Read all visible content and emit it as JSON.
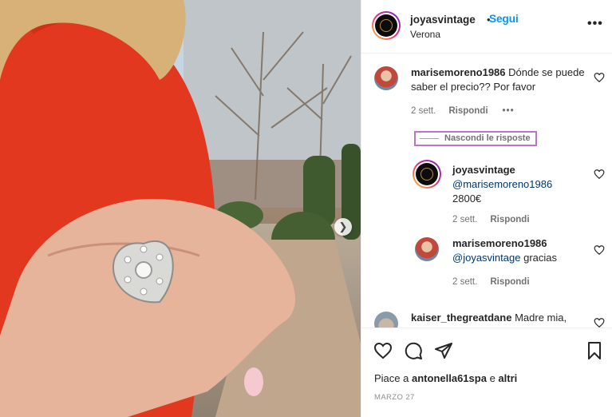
{
  "post": {
    "username": "joyasvintage",
    "separator": "•",
    "follow_label": "Segui",
    "location": "Verona",
    "more": "•••"
  },
  "comments": [
    {
      "username": "marisemoreno1986",
      "text": "Dónde se puede saber el precio?? Por favor",
      "time": "2 sett.",
      "reply_label": "Rispondi",
      "more": "•••"
    },
    {
      "username": "kaiser_thegreatdane",
      "text": "Madre mia,"
    }
  ],
  "hide_replies_label": "Nascondi le risposte",
  "replies": [
    {
      "username": "joyasvintage",
      "mention": "@marisemoreno1986",
      "text": "2800€",
      "time": "2 sett.",
      "reply_label": "Rispondi"
    },
    {
      "username": "marisemoreno1986",
      "mention": "@joyasvintage",
      "text": "gracias",
      "time": "2 sett.",
      "reply_label": "Rispondi"
    }
  ],
  "likes": {
    "prefix": "Piace a",
    "user": "antonella61spa",
    "connector": "e",
    "suffix": "altri"
  },
  "date": "MARZO 27",
  "colors": {
    "link_blue": "#0095f6",
    "mention_blue": "#00376b",
    "secondary_text": "#737373",
    "highlight_box": "#b777c9",
    "coat_red": "#e2381f"
  },
  "icons": [
    "heart-icon",
    "comment-icon",
    "share-icon",
    "bookmark-icon",
    "more-icon",
    "chevron-right-icon"
  ]
}
